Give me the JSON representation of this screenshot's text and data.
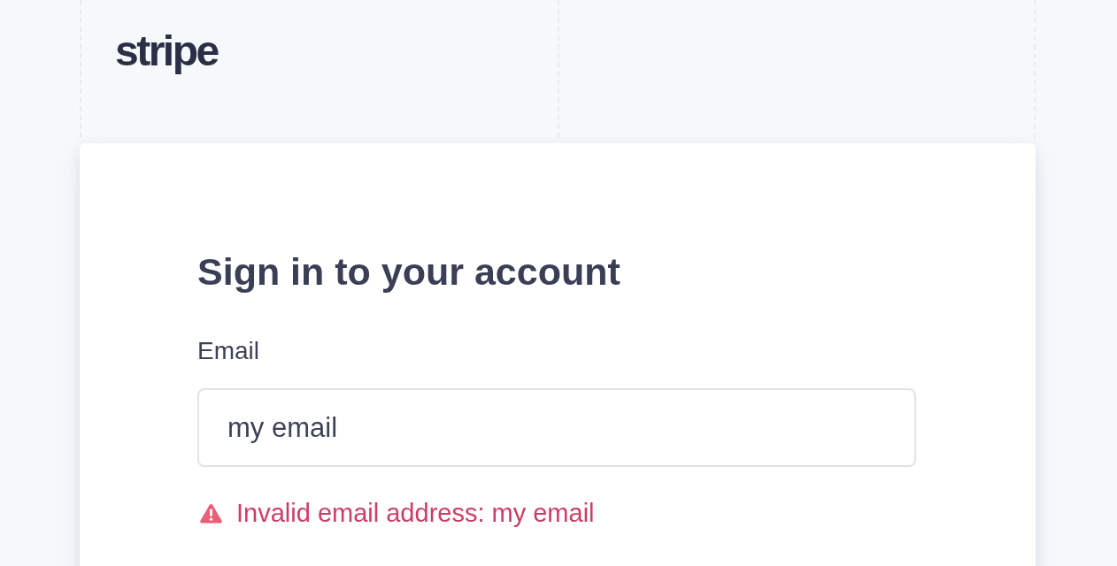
{
  "logo": "stripe",
  "form": {
    "title": "Sign in to your account",
    "fields": [
      {
        "label": "Email",
        "value": "my email",
        "error": "Invalid email address: my email"
      }
    ]
  }
}
